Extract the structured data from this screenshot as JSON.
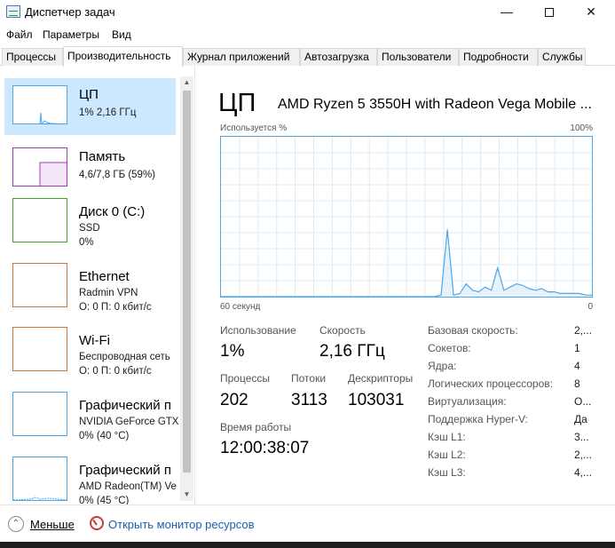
{
  "window": {
    "title": "Диспетчер задач",
    "controls": {
      "minimize": "—",
      "close": "✕"
    }
  },
  "menu": [
    "Файл",
    "Параметры",
    "Вид"
  ],
  "tabs": [
    "Процессы",
    "Производительность",
    "Журнал приложений",
    "Автозагрузка",
    "Пользователи",
    "Подробности",
    "Службы"
  ],
  "active_tab": "Производительность",
  "sidebar": {
    "items": [
      {
        "title": "ЦП",
        "line1": "1% 2,16 ГГц",
        "line2": "",
        "color": "#4da6e8"
      },
      {
        "title": "Память",
        "line1": "4,6/7,8 ГБ (59%)",
        "line2": "",
        "color": "#9b3fb5"
      },
      {
        "title": "Диск 0 (C:)",
        "line1": "SSD",
        "line2": "0%",
        "color": "#4a9a2c"
      },
      {
        "title": "Ethernet",
        "line1": "Radmin VPN",
        "line2": "О: 0 П: 0 кбит/с",
        "color": "#c8763a"
      },
      {
        "title": "Wi-Fi",
        "line1": "Беспроводная сеть",
        "line2": "О: 0 П: 0 кбит/с",
        "color": "#c8763a"
      },
      {
        "title": "Графический п",
        "line1": "NVIDIA GeForce GTX",
        "line2": "0% (40 °C)",
        "color": "#4da6e8"
      },
      {
        "title": "Графический п",
        "line1": "AMD Radeon(TM) Ve",
        "line2": "0% (45 °C)",
        "color": "#4da6e8"
      }
    ]
  },
  "main": {
    "title": "ЦП",
    "cpu_name": "AMD Ryzen 5 3550H with Radeon Vega Mobile ...",
    "graph_label_left": "Используется %",
    "graph_label_right": "100%",
    "axis_left": "60 секунд",
    "axis_right": "0",
    "graph_color": "#4da6e8",
    "graph_usage_percent": [
      0,
      0,
      0,
      0,
      0,
      0,
      0,
      0,
      0,
      0,
      0,
      0,
      0,
      0,
      0,
      0,
      0,
      0,
      0,
      0,
      0,
      0,
      0,
      0,
      0,
      0,
      0,
      0,
      0,
      0,
      0,
      0,
      0,
      0,
      0,
      1,
      42,
      1,
      2,
      8,
      4,
      3,
      6,
      4,
      18,
      4,
      6,
      8,
      7,
      5,
      4,
      5,
      3,
      3,
      2,
      2,
      2,
      2,
      1,
      1
    ],
    "stats": {
      "utilization_label": "Использование",
      "utilization_value": "1%",
      "speed_label": "Скорость",
      "speed_value": "2,16 ГГц",
      "processes_label": "Процессы",
      "processes_value": "202",
      "threads_label": "Потоки",
      "threads_value": "3113",
      "handles_label": "Дескрипторы",
      "handles_value": "103031",
      "uptime_label": "Время работы",
      "uptime_value": "12:00:38:07"
    },
    "specs": [
      {
        "label": "Базовая скорость:",
        "value": "2,..."
      },
      {
        "label": "Сокетов:",
        "value": "1"
      },
      {
        "label": "Ядра:",
        "value": "4"
      },
      {
        "label": "Логических процессоров:",
        "value": "8"
      },
      {
        "label": "Виртуализация:",
        "value": "О..."
      },
      {
        "label": "Поддержка Hyper-V:",
        "value": "Да"
      },
      {
        "label": "Кэш L1:",
        "value": "3..."
      },
      {
        "label": "Кэш L2:",
        "value": "2,..."
      },
      {
        "label": "Кэш L3:",
        "value": "4,..."
      }
    ]
  },
  "footer": {
    "fewer_label": "Меньше",
    "monitor_label": "Открыть монитор ресурсов"
  }
}
